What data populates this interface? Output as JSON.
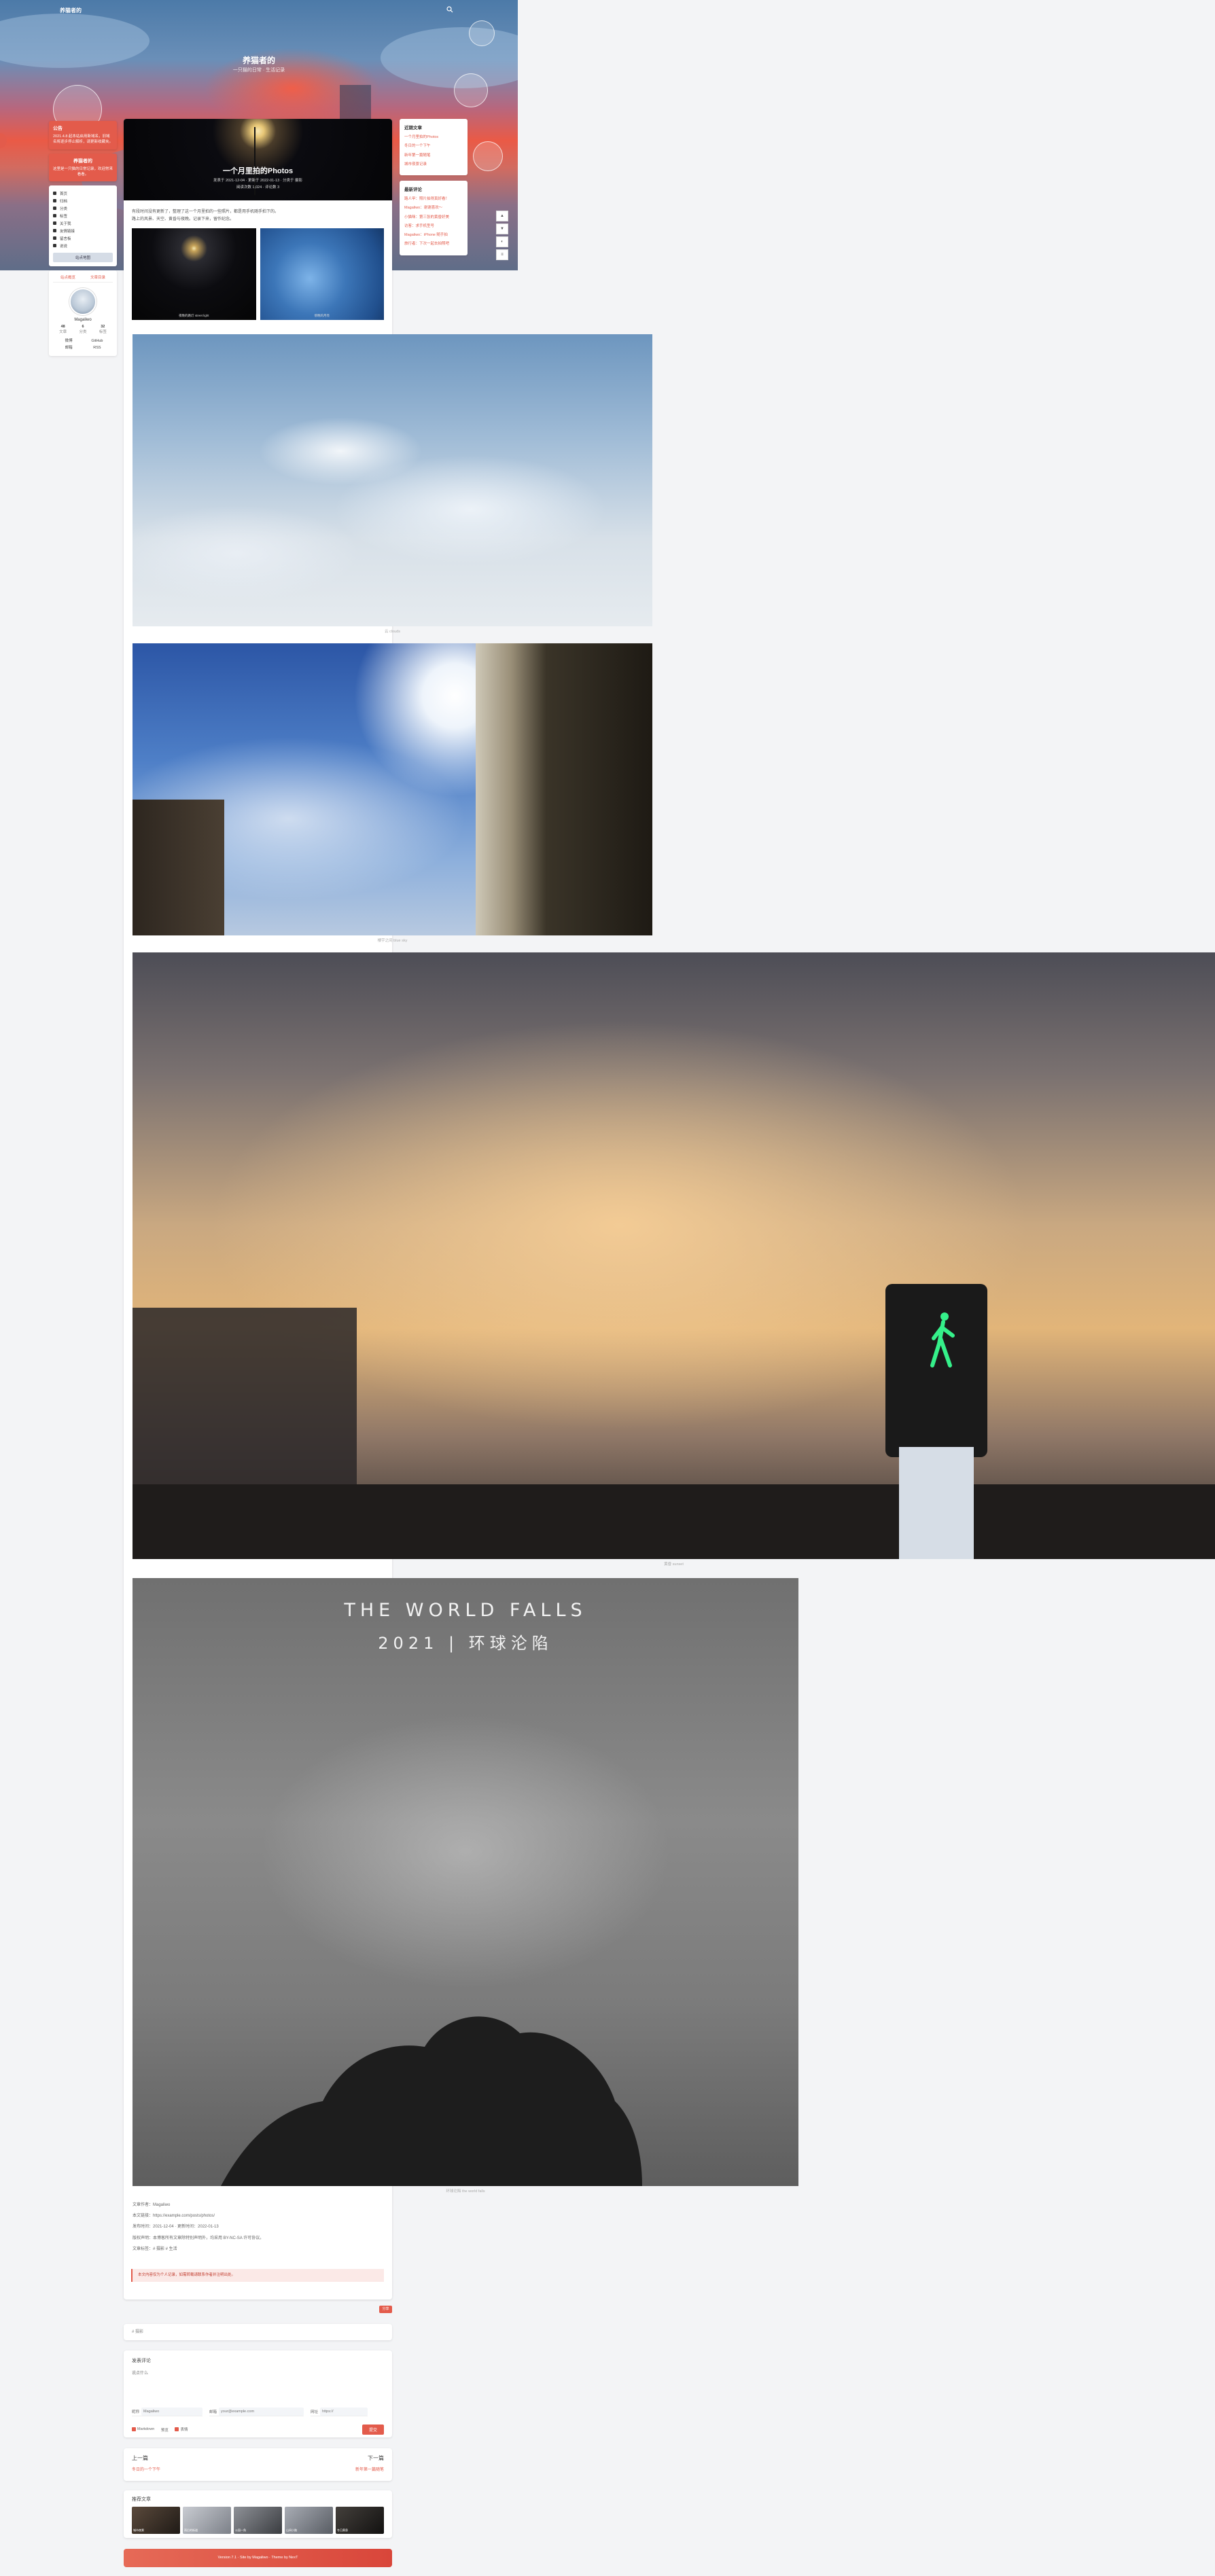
{
  "header": {
    "site_name": "养猫者的",
    "hero_title": "养猫者的",
    "hero_subtitle": "一只猫的日常 · 生活记录"
  },
  "left": {
    "notice_title": "公告",
    "notice_text": "2021.4.8 起本站启用新域名，旧域名将逐步停止解析，请更新收藏夹。",
    "card2_title": "养猫者的",
    "card2_text": "这里是一只猫的日常记录，欢迎常来看看。",
    "nav": [
      {
        "label": "首页",
        "icon": "home-icon"
      },
      {
        "label": "归档",
        "icon": "archive-icon"
      },
      {
        "label": "分类",
        "icon": "folder-icon"
      },
      {
        "label": "标签",
        "icon": "tag-icon"
      },
      {
        "label": "关于我",
        "icon": "user-icon"
      },
      {
        "label": "友情链接",
        "icon": "link-icon"
      },
      {
        "label": "留言板",
        "icon": "message-icon"
      },
      {
        "label": "说说",
        "icon": "chat-icon"
      }
    ],
    "nav_button": "站点地图",
    "profile": {
      "tab1": "站点概览",
      "tab2": "文章目录",
      "name": "Magaliwo",
      "stats": [
        {
          "n": "48",
          "l": "文章"
        },
        {
          "n": "6",
          "l": "分类"
        },
        {
          "n": "32",
          "l": "标签"
        }
      ],
      "links": [
        "微博",
        "GitHub",
        "邮箱",
        "RSS"
      ]
    }
  },
  "article": {
    "cover_title": "一个月里拍的Photos",
    "cover_meta": "发表于 2021-12-04 · 更新于 2022-01-13 · 分类于 摄影",
    "cover_meta2": "阅读次数 1,024 · 评论数 3",
    "intro_line1": "有段时间没有更新了，整理了这一个月里拍的一些照片，都是用手机随手拍下的。",
    "intro_line2": "路上的风景、天空、黄昏与夜晚。记录下来，留作纪念。",
    "thumb1_caption": "夜晚的路灯 street light",
    "thumb2_caption": "傍晚的月亮",
    "photo1_caption": "云 clouds",
    "photo2_caption": "楼宇之间 blue sky",
    "photo3_caption": "黄昏 sunset",
    "photo4_title_line1": "THE WORLD FALLS",
    "photo4_title_line2": "2021 | 环球沦陷",
    "photo4_caption": "环球沦陷 the world falls",
    "meta": [
      "文章作者：Magaliwo",
      "本文链接：https://example.com/posts/photos/",
      "发布时间：2021-12-04 · 更新时间：2022-01-13",
      "版权声明：本博客所有文章除特别声明外，均采用 BY-NC-SA 许可协议。",
      "文章标签：# 摄影 # 生活"
    ],
    "notice": "本文内容仅为个人记录，如需转载请联系作者并注明出处。",
    "share_label": "分享"
  },
  "tags_label": "# 摄影",
  "comment": {
    "title": "发表评论",
    "placeholder": "说点什么",
    "nick_label": "昵称",
    "nick_placeholder": "Magaliwo",
    "mail_label": "邮箱",
    "mail_placeholder": "your@example.com",
    "url_label": "网址",
    "url_placeholder": "https://",
    "check1": "Markdown",
    "check2": "预览",
    "check3": "表情",
    "submit": "提交"
  },
  "post_nav": {
    "prev_label": "上一篇",
    "next_label": "下一篇",
    "prev_title": "冬日的一个下午",
    "next_title": "新年第一篇随笔"
  },
  "recommend": {
    "title": "推荐文章",
    "items": [
      "城市夜景",
      "雨后的街道",
      "公园一角",
      "山间小路",
      "冬日黄昏"
    ]
  },
  "footer": "Version 7.1 · Site by Magaliwo · Theme by NexT",
  "right": {
    "card1_title": "近期文章",
    "card1_items": [
      "一个月里拍的Photos",
      "冬日的一个下午",
      "新年第一篇随笔",
      "城市夜景记录"
    ],
    "card2_title": "最新评论",
    "card2_items": [
      "路人甲：照片拍得真好看！",
      "Magaliwo：谢谢喜欢～",
      "小猫咪：第三张的黄昏好美",
      "访客：求手机型号",
      "Magaliwo：iPhone 随手拍",
      "旅行者：下次一起去拍照吧"
    ],
    "float_buttons": [
      "▲",
      "▼",
      "◐",
      "≡"
    ]
  }
}
